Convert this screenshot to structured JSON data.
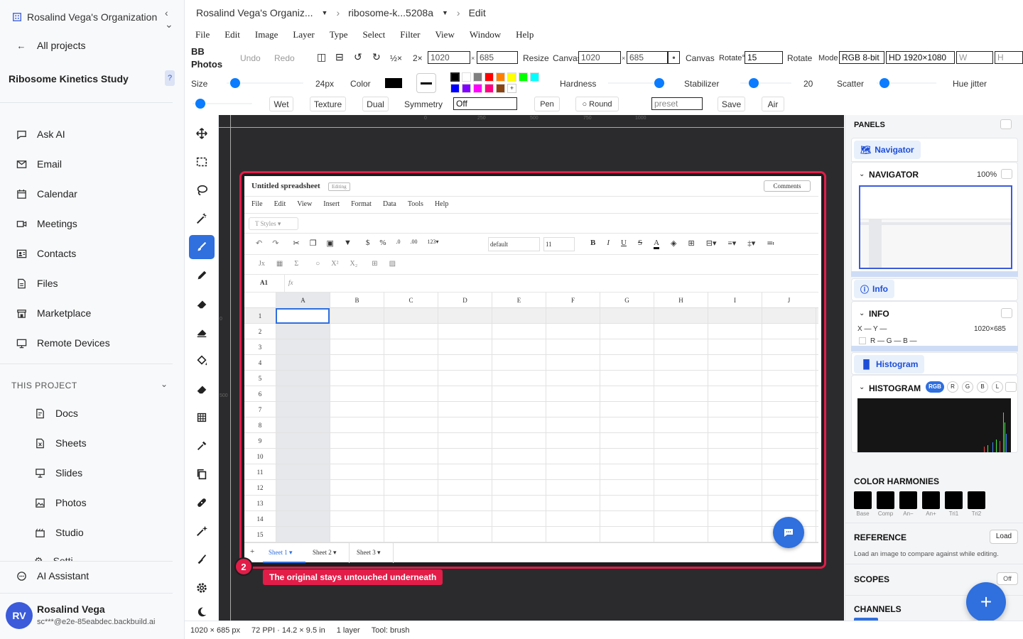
{
  "sidebar": {
    "org": "Rosalind Vega's Organization",
    "all_projects": "All projects",
    "project": "Ribosome Kinetics Study",
    "help": "?",
    "nav": [
      "Ask AI",
      "Email",
      "Calendar",
      "Meetings",
      "Contacts",
      "Files",
      "Marketplace",
      "Remote Devices"
    ],
    "section": "THIS PROJECT",
    "project_items": [
      "Docs",
      "Sheets",
      "Slides",
      "Photos",
      "Studio",
      "Setti..."
    ],
    "assistant": "AI Assistant",
    "user": {
      "initials": "RV",
      "name": "Rosalind Vega",
      "email": "sc***@e2e-85eabdec.backbuild.ai"
    }
  },
  "breadcrumb": {
    "org": "Rosalind Vega's Organiz...",
    "file": "ribosome-k...5208a",
    "mode": "Edit"
  },
  "menu": [
    "File",
    "Edit",
    "Image",
    "Layer",
    "Type",
    "Select",
    "Filter",
    "View",
    "Window",
    "Help"
  ],
  "toolbar": {
    "app1": "BB",
    "app2": "Photos",
    "undo": "Undo",
    "redo": "Redo",
    "half": "½×",
    "double": "2×",
    "w": "1020",
    "h": "685",
    "resize": "Resize",
    "canvas_label": "Canvas",
    "cw": "1020",
    "ch": "685",
    "anchor": "•",
    "canvas_btn": "Canvas",
    "rotate_label": "Rotate°",
    "rotate_val": "15",
    "rotate_btn": "Rotate",
    "mode_label": "Mode",
    "mode_val": "RGB 8-bit",
    "preset": "HD 1920×1080",
    "wph": "W",
    "hph": "H"
  },
  "brush": {
    "size_label": "Size",
    "size_val": "24px",
    "color_label": "Color",
    "hardness": "Hardness",
    "stabilizer": "Stabilizer",
    "stab_val": "20",
    "scatter": "Scatter",
    "hue_jitter": "Hue jitter",
    "size_level": 0.05,
    "hardness_level": 0.95,
    "stabilizer_level": 0.2,
    "scatter_level": 0.05,
    "hue_level": 0.05,
    "wet": "Wet",
    "texture": "Texture",
    "dual": "Dual",
    "symmetry": "Symmetry",
    "sym_val": "Off",
    "pen": "Pen",
    "round": "○ Round",
    "preset_ph": "preset",
    "save": "Save",
    "air": "Air",
    "swatches": [
      "#000000",
      "#ffffff",
      "#808080",
      "#ff0000",
      "#ff8000",
      "#ffff00",
      "#00ff00",
      "#00ffff",
      "#0000ff",
      "#8000ff",
      "#ff00ff",
      "#ff0080",
      "#8b4513"
    ],
    "plus": "+"
  },
  "ruler": [
    "0",
    "250",
    "500",
    "750",
    "1000"
  ],
  "vruler": [
    "0",
    "500"
  ],
  "sheet": {
    "title": "Untitled spreadsheet",
    "badge": "Editing",
    "comments": "Comments",
    "menu": [
      "File",
      "Edit",
      "View",
      "Insert",
      "Format",
      "Data",
      "Tools",
      "Help"
    ],
    "styles": "T Styles ▾",
    "font": "default",
    "fontsize": "11",
    "cellref": "A1",
    "fx": "fx",
    "cols": [
      "A",
      "B",
      "C",
      "D",
      "E",
      "F",
      "G",
      "H",
      "I",
      "J"
    ],
    "rows": [
      "1",
      "2",
      "3",
      "4",
      "5",
      "6",
      "7",
      "8",
      "9",
      "10",
      "11",
      "12",
      "13",
      "14",
      "15"
    ],
    "tabs": [
      "Sheet 1",
      "Sheet 2",
      "Sheet 3"
    ],
    "add": "+"
  },
  "callout": {
    "num": "2",
    "text": "The original stays untouched underneath"
  },
  "panels": {
    "title": "PANELS",
    "navigator_tab": "Navigator",
    "navigator": "NAVIGATOR",
    "zoom": "100%",
    "info_tab": "Info",
    "info": "INFO",
    "xy": "X — Y —",
    "dims": "1020×685",
    "rgb": "R — G — B —",
    "hist_tab": "Histogram",
    "histogram": "HISTOGRAM",
    "hist_btns": [
      "RGB",
      "R",
      "G",
      "B",
      "L"
    ],
    "harmonies": "COLOR HARMONIES",
    "harm_labels": [
      "Base",
      "Comp",
      "An−",
      "An+",
      "Tri1",
      "Tri2"
    ],
    "reference": "REFERENCE",
    "load": "Load",
    "ref_desc": "Load an image to compare against while editing.",
    "scopes": "SCOPES",
    "off": "Off",
    "channels": "CHANNELS"
  },
  "status": {
    "dims": "1020 × 685 px",
    "ppi": "72 PPI · 14.2 × 9.5 in",
    "layers": "1 layer",
    "tool": "Tool: brush"
  },
  "colors": {
    "accent": "#0a7cff",
    "red": "#e11d48",
    "blue": "#2f6fde"
  }
}
